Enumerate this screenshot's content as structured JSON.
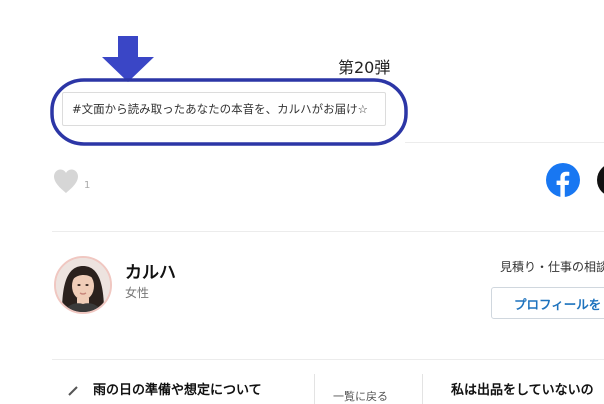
{
  "article": {
    "episode_label": "第20弾",
    "hashtag": "#文面から読み取ったあなたの本音を、カルハがお届け☆"
  },
  "annotation": {
    "arrow_color": "#3a46c6",
    "ellipse_color": "#2c36a6"
  },
  "reactions": {
    "like_count": "1",
    "like_icon": "heart-icon"
  },
  "share": {
    "facebook_color": "#1877f2",
    "x_color": "#111111"
  },
  "author": {
    "name": "カルハ",
    "gender": "女性",
    "quote_text": "見積り・仕事の相談",
    "profile_button": "プロフィールを"
  },
  "pager": {
    "prev_title": "雨の日の準備や想定について",
    "back_label": "一覧に戻る",
    "next_title": "私は出品をしていないの"
  }
}
